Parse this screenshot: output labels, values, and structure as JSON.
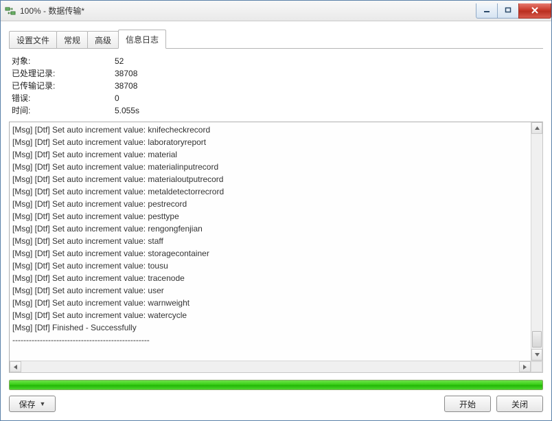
{
  "window": {
    "title": "100% - 数据传输*",
    "icon": "data-transfer-icon"
  },
  "tabs": [
    {
      "label": "设置文件",
      "active": false
    },
    {
      "label": "常规",
      "active": false
    },
    {
      "label": "高级",
      "active": false
    },
    {
      "label": "信息日志",
      "active": true
    }
  ],
  "stats": {
    "labels": {
      "objects": "对象:",
      "processed": "已处理记录:",
      "transferred": "已传输记录:",
      "errors": "错误:",
      "time": "时间:"
    },
    "values": {
      "objects": "52",
      "processed": "38708",
      "transferred": "38708",
      "errors": "0",
      "time": "5.055s"
    }
  },
  "log_lines": [
    "[Msg] [Dtf] Set auto increment value: knifecheckrecord",
    "[Msg] [Dtf] Set auto increment value: laboratoryreport",
    "[Msg] [Dtf] Set auto increment value: material",
    "[Msg] [Dtf] Set auto increment value: materialinputrecord",
    "[Msg] [Dtf] Set auto increment value: materialoutputrecord",
    "[Msg] [Dtf] Set auto increment value: metaldetectorrecrord",
    "[Msg] [Dtf] Set auto increment value: pestrecord",
    "[Msg] [Dtf] Set auto increment value: pesttype",
    "[Msg] [Dtf] Set auto increment value: rengongfenjian",
    "[Msg] [Dtf] Set auto increment value: staff",
    "[Msg] [Dtf] Set auto increment value: storagecontainer",
    "[Msg] [Dtf] Set auto increment value: tousu",
    "[Msg] [Dtf] Set auto increment value: tracenode",
    "[Msg] [Dtf] Set auto increment value: user",
    "[Msg] [Dtf] Set auto increment value: warnweight",
    "[Msg] [Dtf] Set auto increment value: watercycle",
    "[Msg] [Dtf] Finished - Successfully",
    "--------------------------------------------------"
  ],
  "progress_percent": 100,
  "buttons": {
    "save": "保存",
    "start": "开始",
    "close": "关闭"
  },
  "colors": {
    "progress_fill": "#3bcf18",
    "titlebar_text": "#333333"
  }
}
